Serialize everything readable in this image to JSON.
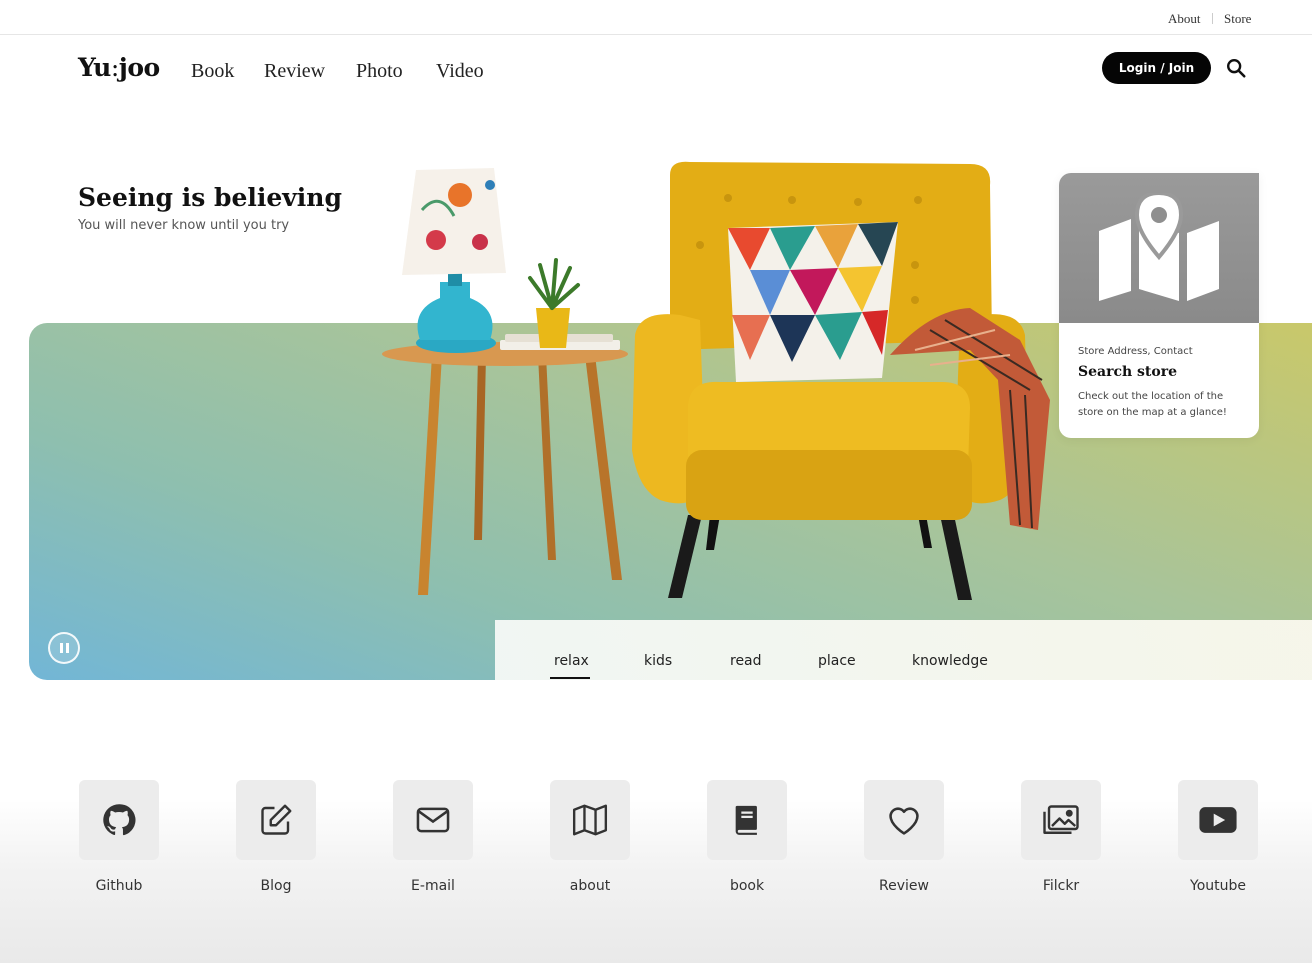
{
  "utility_nav": {
    "about": "About",
    "store": "Store"
  },
  "header": {
    "logo_main": "Yu",
    "logo_colon": ":",
    "logo_end": "joo",
    "nav": [
      "Book",
      "Review",
      "Photo",
      "Video"
    ],
    "login_label": "Login / Join",
    "search_icon": "search-icon"
  },
  "hero": {
    "title": "Seeing is believing",
    "subtitle": "You will never know until you try",
    "tabs": [
      "relax",
      "kids",
      "read",
      "place",
      "knowledge"
    ],
    "active_tab": "relax",
    "gradient_colors": [
      "#72b6d6",
      "#8ebfaf",
      "#a8c49a",
      "#c9c86a"
    ]
  },
  "store_card": {
    "icon": "map-pin-icon",
    "kicker": "Store Address, Contact",
    "title": "Search store",
    "description": "Check out the location of the store on the map at a glance!"
  },
  "shortcuts": [
    {
      "label": "Github",
      "icon": "github-icon"
    },
    {
      "label": "Blog",
      "icon": "edit-icon"
    },
    {
      "label": "E-mail",
      "icon": "mail-icon"
    },
    {
      "label": "about",
      "icon": "map-icon"
    },
    {
      "label": "book",
      "icon": "book-icon"
    },
    {
      "label": "Review",
      "icon": "heart-icon"
    },
    {
      "label": "Filckr",
      "icon": "image-icon"
    },
    {
      "label": "Youtube",
      "icon": "youtube-icon"
    }
  ],
  "colors": {
    "accent": "#050505",
    "chair": "#e8b51a",
    "card_gray": "#929292"
  }
}
